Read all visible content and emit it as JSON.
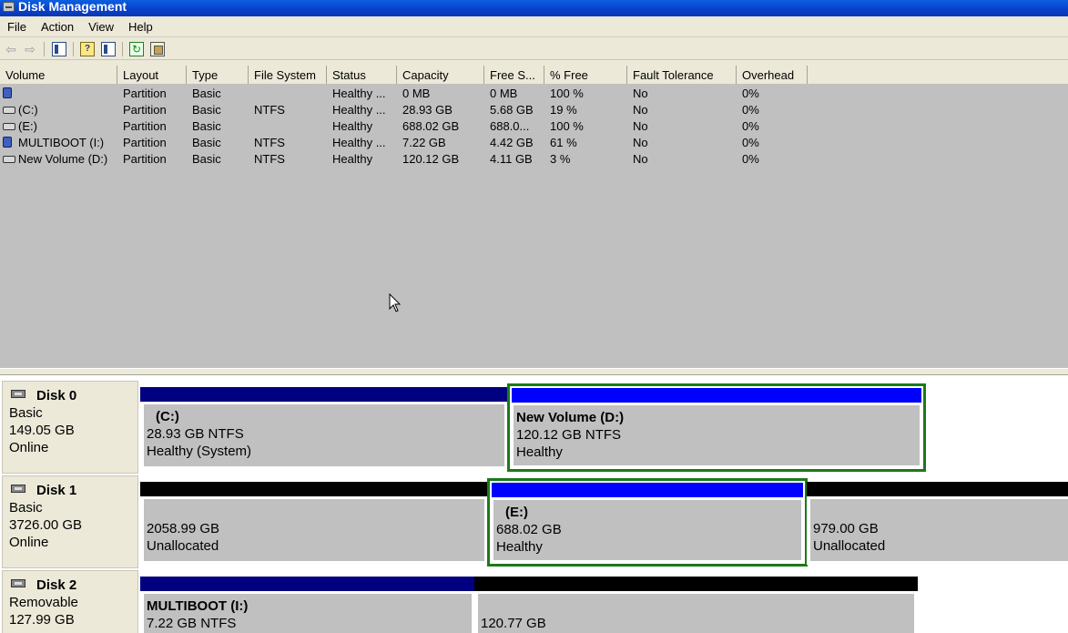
{
  "window": {
    "title": "Disk Management"
  },
  "menu": [
    "File",
    "Action",
    "View",
    "Help"
  ],
  "list": {
    "columns": [
      "Volume",
      "Layout",
      "Type",
      "File System",
      "Status",
      "Capacity",
      "Free S...",
      "% Free",
      "Fault Tolerance",
      "Overhead"
    ],
    "rows": [
      {
        "icon": "usb-drive-icon",
        "volume": "",
        "layout": "Partition",
        "type": "Basic",
        "fs": "",
        "status": "Healthy ...",
        "capacity": "0 MB",
        "free": "0 MB",
        "pct": "100 %",
        "fault": "No",
        "overhead": "0%"
      },
      {
        "icon": "drive-icon",
        "volume": "(C:)",
        "layout": "Partition",
        "type": "Basic",
        "fs": "NTFS",
        "status": "Healthy ...",
        "capacity": "28.93 GB",
        "free": "5.68 GB",
        "pct": "19 %",
        "fault": "No",
        "overhead": "0%"
      },
      {
        "icon": "drive-icon",
        "volume": "(E:)",
        "layout": "Partition",
        "type": "Basic",
        "fs": "",
        "status": "Healthy",
        "capacity": "688.02 GB",
        "free": "688.0...",
        "pct": "100 %",
        "fault": "No",
        "overhead": "0%"
      },
      {
        "icon": "usb-drive-icon",
        "volume": "MULTIBOOT (I:)",
        "layout": "Partition",
        "type": "Basic",
        "fs": "NTFS",
        "status": "Healthy ...",
        "capacity": "7.22 GB",
        "free": "4.42 GB",
        "pct": "61 %",
        "fault": "No",
        "overhead": "0%"
      },
      {
        "icon": "drive-icon",
        "volume": "New Volume (D:)",
        "layout": "Partition",
        "type": "Basic",
        "fs": "NTFS",
        "status": "Healthy",
        "capacity": "120.12 GB",
        "free": "4.11 GB",
        "pct": "3 %",
        "fault": "No",
        "overhead": "0%"
      }
    ]
  },
  "disks": [
    {
      "name": "Disk 0",
      "kind": "Basic",
      "size": "149.05 GB",
      "state": "Online",
      "partitions": [
        {
          "title": "(C:)",
          "line1": "28.93 GB NTFS",
          "line2": "Healthy (System)",
          "bar": "primary"
        },
        {
          "title": "New Volume  (D:)",
          "line1": "120.12 GB NTFS",
          "line2": "Healthy",
          "bar": "bright",
          "selected": true
        }
      ]
    },
    {
      "name": "Disk 1",
      "kind": "Basic",
      "size": "3726.00 GB",
      "state": "Online",
      "partitions": [
        {
          "title": "",
          "line1": "2058.99 GB",
          "line2": "Unallocated",
          "bar": "unalloc"
        },
        {
          "title": "(E:)",
          "line1": "688.02 GB",
          "line2": "Healthy",
          "bar": "bright",
          "selected": true
        },
        {
          "title": "",
          "line1": "979.00 GB",
          "line2": "Unallocated",
          "bar": "unalloc"
        }
      ]
    },
    {
      "name": "Disk 2",
      "kind": "Removable",
      "size": "127.99 GB",
      "state": "",
      "partitions": [
        {
          "title": "MULTIBOOT  (I:)",
          "line1": "7.22 GB NTFS",
          "line2": "",
          "bar": "primary"
        },
        {
          "title": "",
          "line1": "120.77 GB",
          "line2": "",
          "bar": "unalloc"
        }
      ]
    }
  ],
  "colors": {
    "primary": "#000080",
    "logical": "#0000ff",
    "unallocated": "#000000",
    "selection": "#1a7a1a"
  }
}
